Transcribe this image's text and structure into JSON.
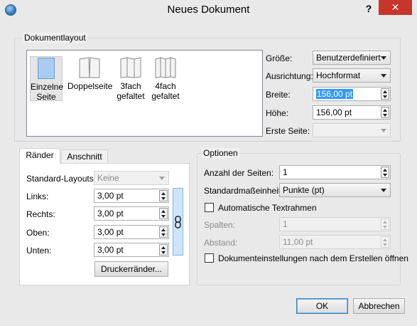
{
  "window": {
    "title": "Neues Dokument",
    "help": "?",
    "close": "✕"
  },
  "layout_group": {
    "title": "Dokumentlayout",
    "items": [
      {
        "label": "Einzelne\nSeite"
      },
      {
        "label": "Doppelseite"
      },
      {
        "label": "3fach\ngefaltet"
      },
      {
        "label": "4fach\ngefaltet"
      }
    ],
    "size_label": "Größe:",
    "size_value": "Benutzerdefiniert",
    "orientation_label": "Ausrichtung:",
    "orientation_value": "Hochformat",
    "width_label": "Breite:",
    "width_value": "156,00 pt",
    "height_label": "Höhe:",
    "height_value": "156,00 pt",
    "first_page_label": "Erste Seite:",
    "first_page_value": ""
  },
  "tabs": {
    "margins": "Ränder",
    "bleed": "Anschnitt"
  },
  "margins": {
    "preset_label": "Standard-Layouts:",
    "preset_value": "Keine",
    "left_label": "Links:",
    "left_value": "3,00 pt",
    "right_label": "Rechts:",
    "right_value": "3,00 pt",
    "top_label": "Oben:",
    "top_value": "3,00 pt",
    "bottom_label": "Unten:",
    "bottom_value": "3,00 pt",
    "printer_margins_button": "Druckerränder..."
  },
  "options": {
    "title": "Optionen",
    "pages_label": "Anzahl der Seiten:",
    "pages_value": "1",
    "unit_label": "Standardmaßeinheit:",
    "unit_value": "Punkte (pt)",
    "auto_frames_label": "Automatische Textrahmen",
    "columns_label": "Spalten:",
    "columns_value": "1",
    "gap_label": "Abstand:",
    "gap_value": "11,00 pt",
    "open_settings_label": "Dokumenteinstellungen nach dem Erstellen öffnen"
  },
  "buttons": {
    "ok": "OK",
    "cancel": "Abbrechen"
  }
}
